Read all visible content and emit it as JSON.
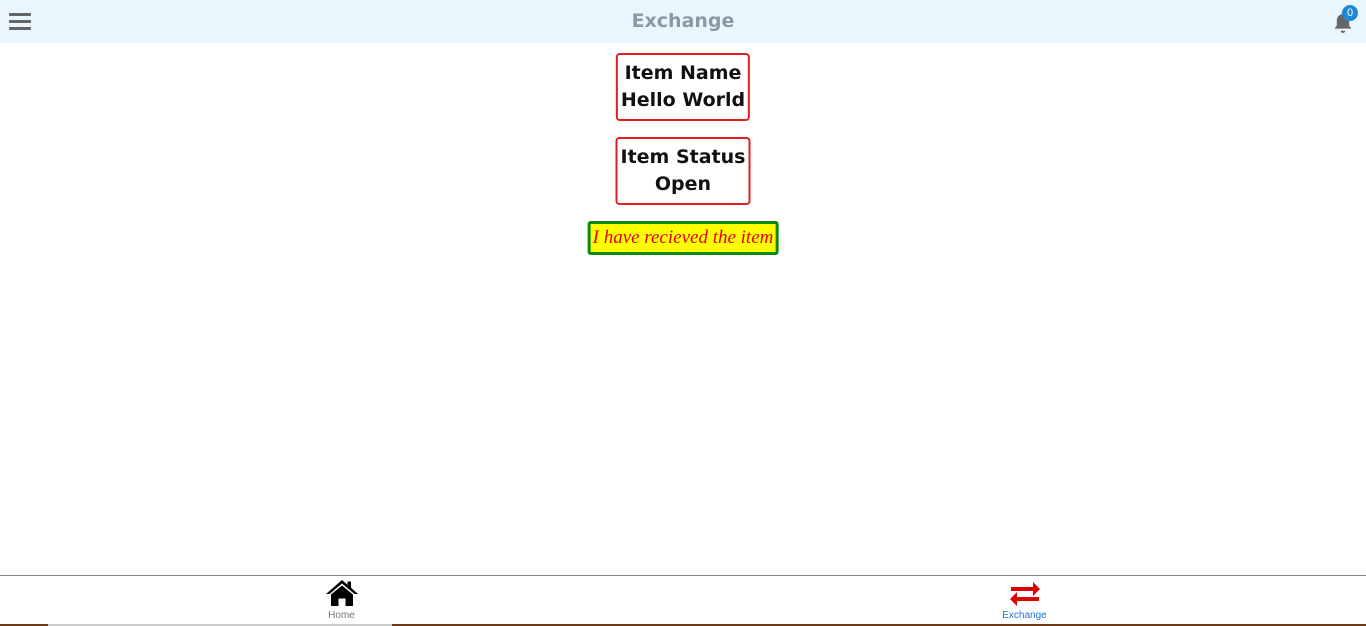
{
  "header": {
    "title": "Exchange",
    "menu_icon": "hamburger-menu-icon",
    "notification_icon": "bell-icon",
    "notification_count": "0"
  },
  "main": {
    "item_name_label": "Item Name",
    "item_name_value": "Hello World",
    "item_status_label": "Item Status",
    "item_status_value": "Open",
    "received_button_label": "I have recieved the item"
  },
  "bottom_nav": {
    "items": [
      {
        "label": "Home",
        "icon": "home-icon"
      },
      {
        "label": "Exchange",
        "icon": "exchange-arrows-icon",
        "active": true
      }
    ]
  },
  "colors": {
    "header_bg": "#eaf6fd",
    "box_border": "#e02020",
    "button_bg": "#ffff00",
    "button_border": "#0a8a0a",
    "button_text": "#e0001a",
    "active_nav": "#1e6fd6",
    "badge": "#1e88d6"
  }
}
